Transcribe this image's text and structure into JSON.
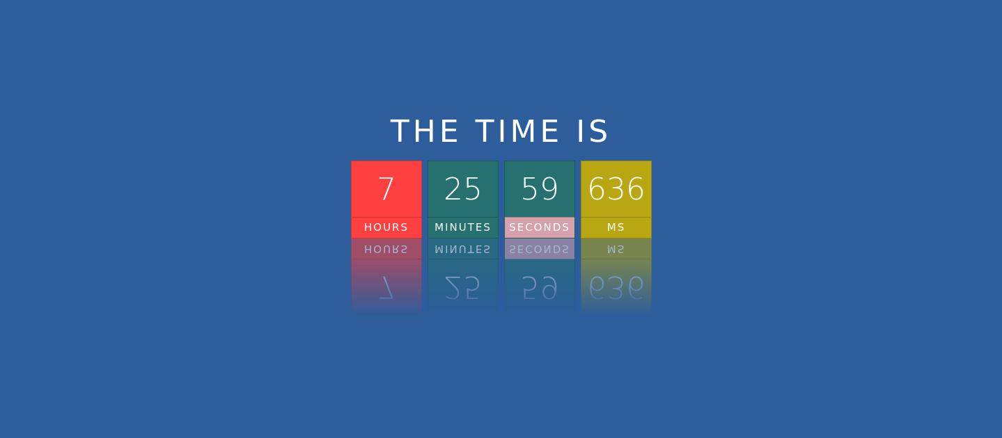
{
  "title": "THE TIME IS",
  "units": [
    {
      "value": "7",
      "label": "HOURS",
      "box_color": "#ff4040",
      "label_color": "#ff4040"
    },
    {
      "value": "25",
      "label": "MINUTES",
      "box_color": "#267170",
      "label_color": "#267170"
    },
    {
      "value": "59",
      "label": "SECONDS",
      "box_color": "#267170",
      "label_color": "#d6a1aa"
    },
    {
      "value": "636",
      "label": "MS",
      "box_color": "#b8a713",
      "label_color": "#b8a713"
    }
  ],
  "colors": {
    "background": "#2d5d9a",
    "text": "#ffffff"
  }
}
